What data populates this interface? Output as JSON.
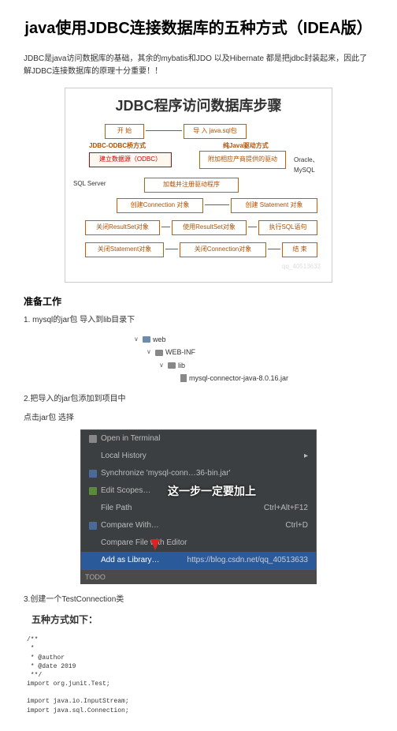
{
  "title": "java使用JDBC连接数据库的五种方式（IDEA版）",
  "intro": "JDBC是java访问数据库的基础，其余的mybatis和JDO 以及Hibernate 都是把jdbc封装起来，因此了解JDBC连接数据库的原理十分重要！！",
  "diagram": {
    "title": "JDBC程序访问数据库步骤",
    "headers": {
      "odbc": "JDBC-ODBC桥方式",
      "java": "纯Java驱动方式"
    },
    "boxes": {
      "start": "开 始",
      "import": "导 入 java.sql包",
      "odbc_ds": "建立数据源（ODBC）",
      "driver_jar": "附加相应产商提供的驱动",
      "load": "加载并注册驱动程序",
      "conn": "创建Connection 对象",
      "stmt": "创建 Statement 对象",
      "close_rs": "关闭ResultSet对象",
      "use_rs": "使用ResultSet对象",
      "exec": "执行SQL语句",
      "close_stmt": "关闭Statement对象",
      "close_conn": "关闭Connection对象",
      "end": "结 束"
    },
    "labels": {
      "sqlserver": "SQL Server",
      "oracle": "Oracle、MySQL"
    },
    "watermark": "qq_40513633"
  },
  "section_prepare": "准备工作",
  "step1": "1. mysql的jar包 导入到lib目录下",
  "tree": {
    "web": "web",
    "webinf": "WEB-INF",
    "lib": "lib",
    "jar": "mysql-connector-java-8.0.16.jar"
  },
  "step2": "2.把导入的jar包添加到项目中",
  "step2_sub": " 点击jar包  选择",
  "ctx": {
    "open_terminal": "Open in Terminal",
    "local_history": "Local History",
    "synchronize": "Synchronize 'mysql-conn…36-bin.jar'",
    "edit_scope": "Edit Scopes…",
    "file_path": "File Path",
    "file_path_key": "Ctrl+Alt+F12",
    "compare_with": "Compare With…",
    "compare_with_key": "Ctrl+D",
    "compare_editor": "Compare File with Editor",
    "add_library": "Add as Library…",
    "overlay": "这一步一定要加上",
    "footer_left": "TODO",
    "footer_right": "https://blog.csdn.net/qq_40513633"
  },
  "step3": "3.创建一个TestConnection类",
  "five_ways": "五种方式如下：",
  "code": "/**\n *\n * @author\n * @date 2019\n **/\nimport org.junit.Test;\n\nimport java.io.InputStream;\nimport java.sql.Connection;"
}
